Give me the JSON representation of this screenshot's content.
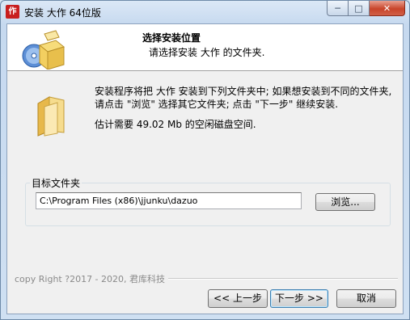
{
  "window": {
    "app_icon_text": "作",
    "title": "安装 大作 64位版",
    "minimize_glyph": "─",
    "maximize_glyph": "□",
    "close_glyph": "✕"
  },
  "header": {
    "title": "选择安装位置",
    "subtitle": "请选择安装 大作 的文件夹."
  },
  "icons": {
    "setup": "setup-box-cd-icon",
    "folder": "folder-icon"
  },
  "body": {
    "description": "安装程序将把 大作 安装到下列文件夹中; 如果想安装到不同的文件夹, 请点击 \"浏览\" 选择其它文件夹; 点击 \"下一步\" 继续安装.",
    "space_required": "估计需要 49.02 Mb 的空闲磁盘空间."
  },
  "destination": {
    "group_label": "目标文件夹",
    "path": "C:\\Program Files (x86)\\jjunku\\dazuo",
    "browse_label": "浏览..."
  },
  "footer": {
    "copyright": "copy Right ?2017 - 2020, 君库科技",
    "back_label": "<< 上一步",
    "next_label": "下一步 >>",
    "cancel_label": "取消"
  }
}
